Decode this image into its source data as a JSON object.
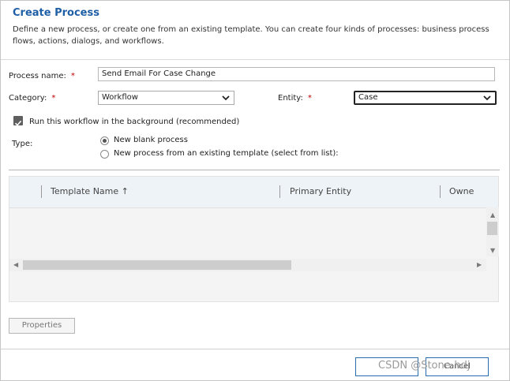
{
  "dialog": {
    "title": "Create Process",
    "description": "Define a new process, or create one from an existing template. You can create four kinds of processes: business process flows, actions, dialogs, and workflows."
  },
  "form": {
    "process_name_label": "Process name:",
    "process_name_value": "Send Email For Case Change",
    "category_label": "Category:",
    "category_value": "Workflow",
    "entity_label": "Entity:",
    "entity_value": "Case",
    "required_marker": "*",
    "background_checkbox_label": "Run this workflow in the background (recommended)",
    "background_checked": true,
    "type_label": "Type:",
    "type_options": [
      {
        "label": "New blank process",
        "selected": true
      },
      {
        "label": "New process from an existing template (select from list):",
        "selected": false
      }
    ]
  },
  "grid": {
    "columns": [
      "Template Name ↑",
      "Primary Entity",
      "Owne"
    ]
  },
  "buttons": {
    "properties": "Properties",
    "ok": "",
    "cancel": "Cancel"
  },
  "watermark": "CSDN @Stone-hdj",
  "colors": {
    "title": "#1f5fa6",
    "required": "#c00000",
    "button_border": "#2b6cb0"
  }
}
